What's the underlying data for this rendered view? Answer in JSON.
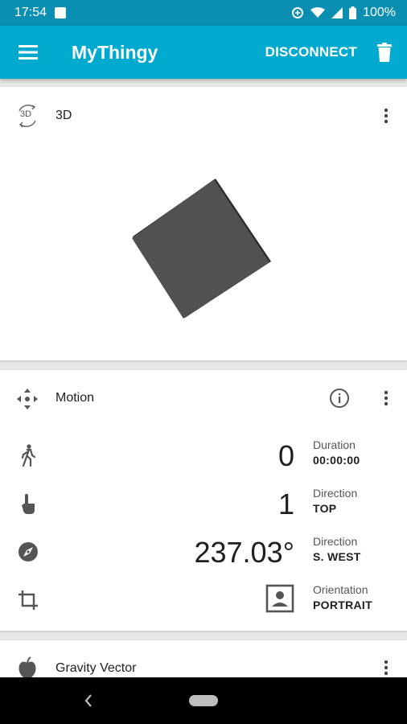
{
  "status_bar": {
    "time": "17:54",
    "battery": "100%"
  },
  "app_bar": {
    "title": "MyThingy",
    "disconnect_label": "DISCONNECT",
    "menu_icon": "hamburger-menu-icon",
    "trash_icon": "trash-icon"
  },
  "card_3d": {
    "icon_text": "3D",
    "title": "3D"
  },
  "card_motion": {
    "title": "Motion",
    "rows": [
      {
        "icon": "walk-icon",
        "value": "0",
        "label": "Duration",
        "sub": "00:00:00"
      },
      {
        "icon": "tap-icon",
        "value": "1",
        "label": "Direction",
        "sub": "TOP"
      },
      {
        "icon": "compass-icon",
        "value": "237.03°",
        "label": "Direction",
        "sub": "S. WEST"
      },
      {
        "icon": "crop-rotate-icon",
        "value": "",
        "label": "Orientation",
        "sub": "PORTRAIT"
      }
    ]
  },
  "card_gravity": {
    "title": "Gravity Vector"
  },
  "colors": {
    "status_bar": "#0a8fb3",
    "app_bar": "#00a9ce",
    "background": "#e6e6e6",
    "cube": "#4a4a4a"
  }
}
